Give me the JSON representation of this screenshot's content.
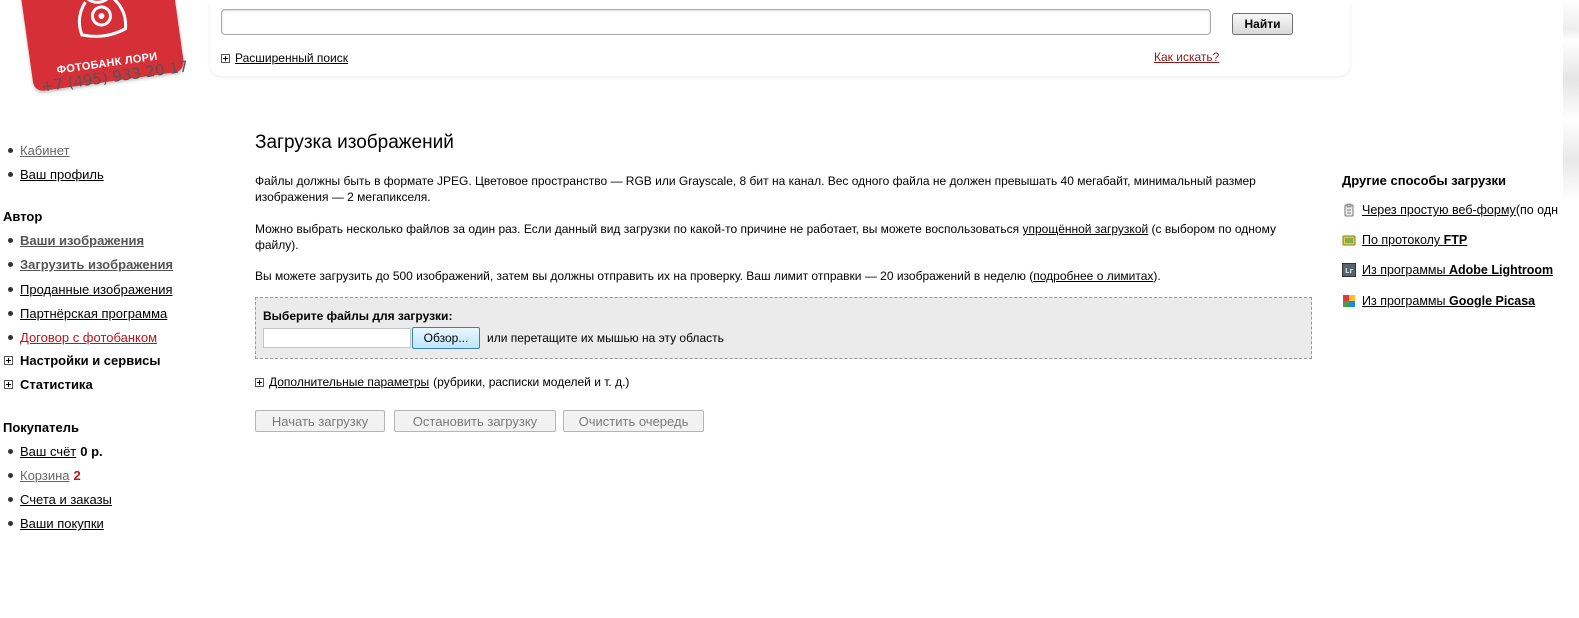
{
  "header": {
    "logo_text": "ФОТОБАНК ЛОРИ",
    "phone": "+7 (495) 933 20 17",
    "search": {
      "value": "",
      "placeholder": "",
      "button_label": "Найти"
    },
    "advanced_search_label": "Расширенный поиск",
    "how_to_search_label": "Как искать?"
  },
  "sidebar": {
    "top_items": [
      {
        "label": "Кабинет"
      },
      {
        "label": "Ваш профиль"
      }
    ],
    "author": {
      "heading": "Автор",
      "items": [
        {
          "label": "Ваши изображения"
        },
        {
          "label": "Загрузить изображения"
        },
        {
          "label": "Проданные изображения"
        },
        {
          "label": "Партнёрская программа"
        },
        {
          "label": "Договор с фотобанком"
        }
      ],
      "toggles": [
        {
          "label": "Настройки и сервисы"
        },
        {
          "label": "Статистика"
        }
      ]
    },
    "buyer": {
      "heading": "Покупатель",
      "account_label": "Ваш счёт",
      "account_value": "0 р.",
      "cart_label": "Корзина",
      "cart_count": "2",
      "orders_label": "Счета и заказы",
      "purchases_label": "Ваши покупки"
    }
  },
  "main": {
    "title": "Загрузка изображений",
    "para1": "Файлы должны быть в формате JPEG. Цветовое пространство — RGB или Grayscale, 8 бит на канал. Вес одного файла не должен превышать 40 мегабайт, минимальный размер изображения — 2 мегапикселя.",
    "para2_before": "Можно выбрать несколько файлов за один раз. Если данный вид загрузки по какой-то причине не работает, вы можете воспользоваться ",
    "para2_link": "упрощённой загрузкой",
    "para2_after": " (с выбором по одному файлу).",
    "para3_before": "Вы можете загрузить до 500 изображений, затем вы должны отправить их на проверку. Ваш лимит отправки — 20 изображений в неделю (",
    "para3_link": "подробнее о лимитах",
    "para3_after": ").",
    "drop_zone": {
      "title": "Выберите файлы для загрузки:",
      "browse_label": "Обзор...",
      "hint": "или перетащите их мышью на эту область"
    },
    "extra_params_link": "Дополнительные параметры",
    "extra_params_note": "(рубрики, расписки моделей и т. д.)",
    "buttons": {
      "start": "Начать загрузку",
      "stop": "Остановить загрузку",
      "clear": "Очистить очередь"
    }
  },
  "other_methods": {
    "title": "Другие способы загрузки",
    "web_form_link": "Через простую веб-форму",
    "web_form_note": " (по одн",
    "ftp_prefix": "По протоколу ",
    "ftp_bold": "FTP",
    "lightroom_prefix": "Из программы ",
    "lightroom_bold": "Adobe Lightroom",
    "picasa_prefix": "Из программы ",
    "picasa_bold": "Google Picasa"
  },
  "colors": {
    "brand_red": "#d72f37",
    "link_red": "#c0121a",
    "drop_zone_bg": "#ebebeb"
  }
}
